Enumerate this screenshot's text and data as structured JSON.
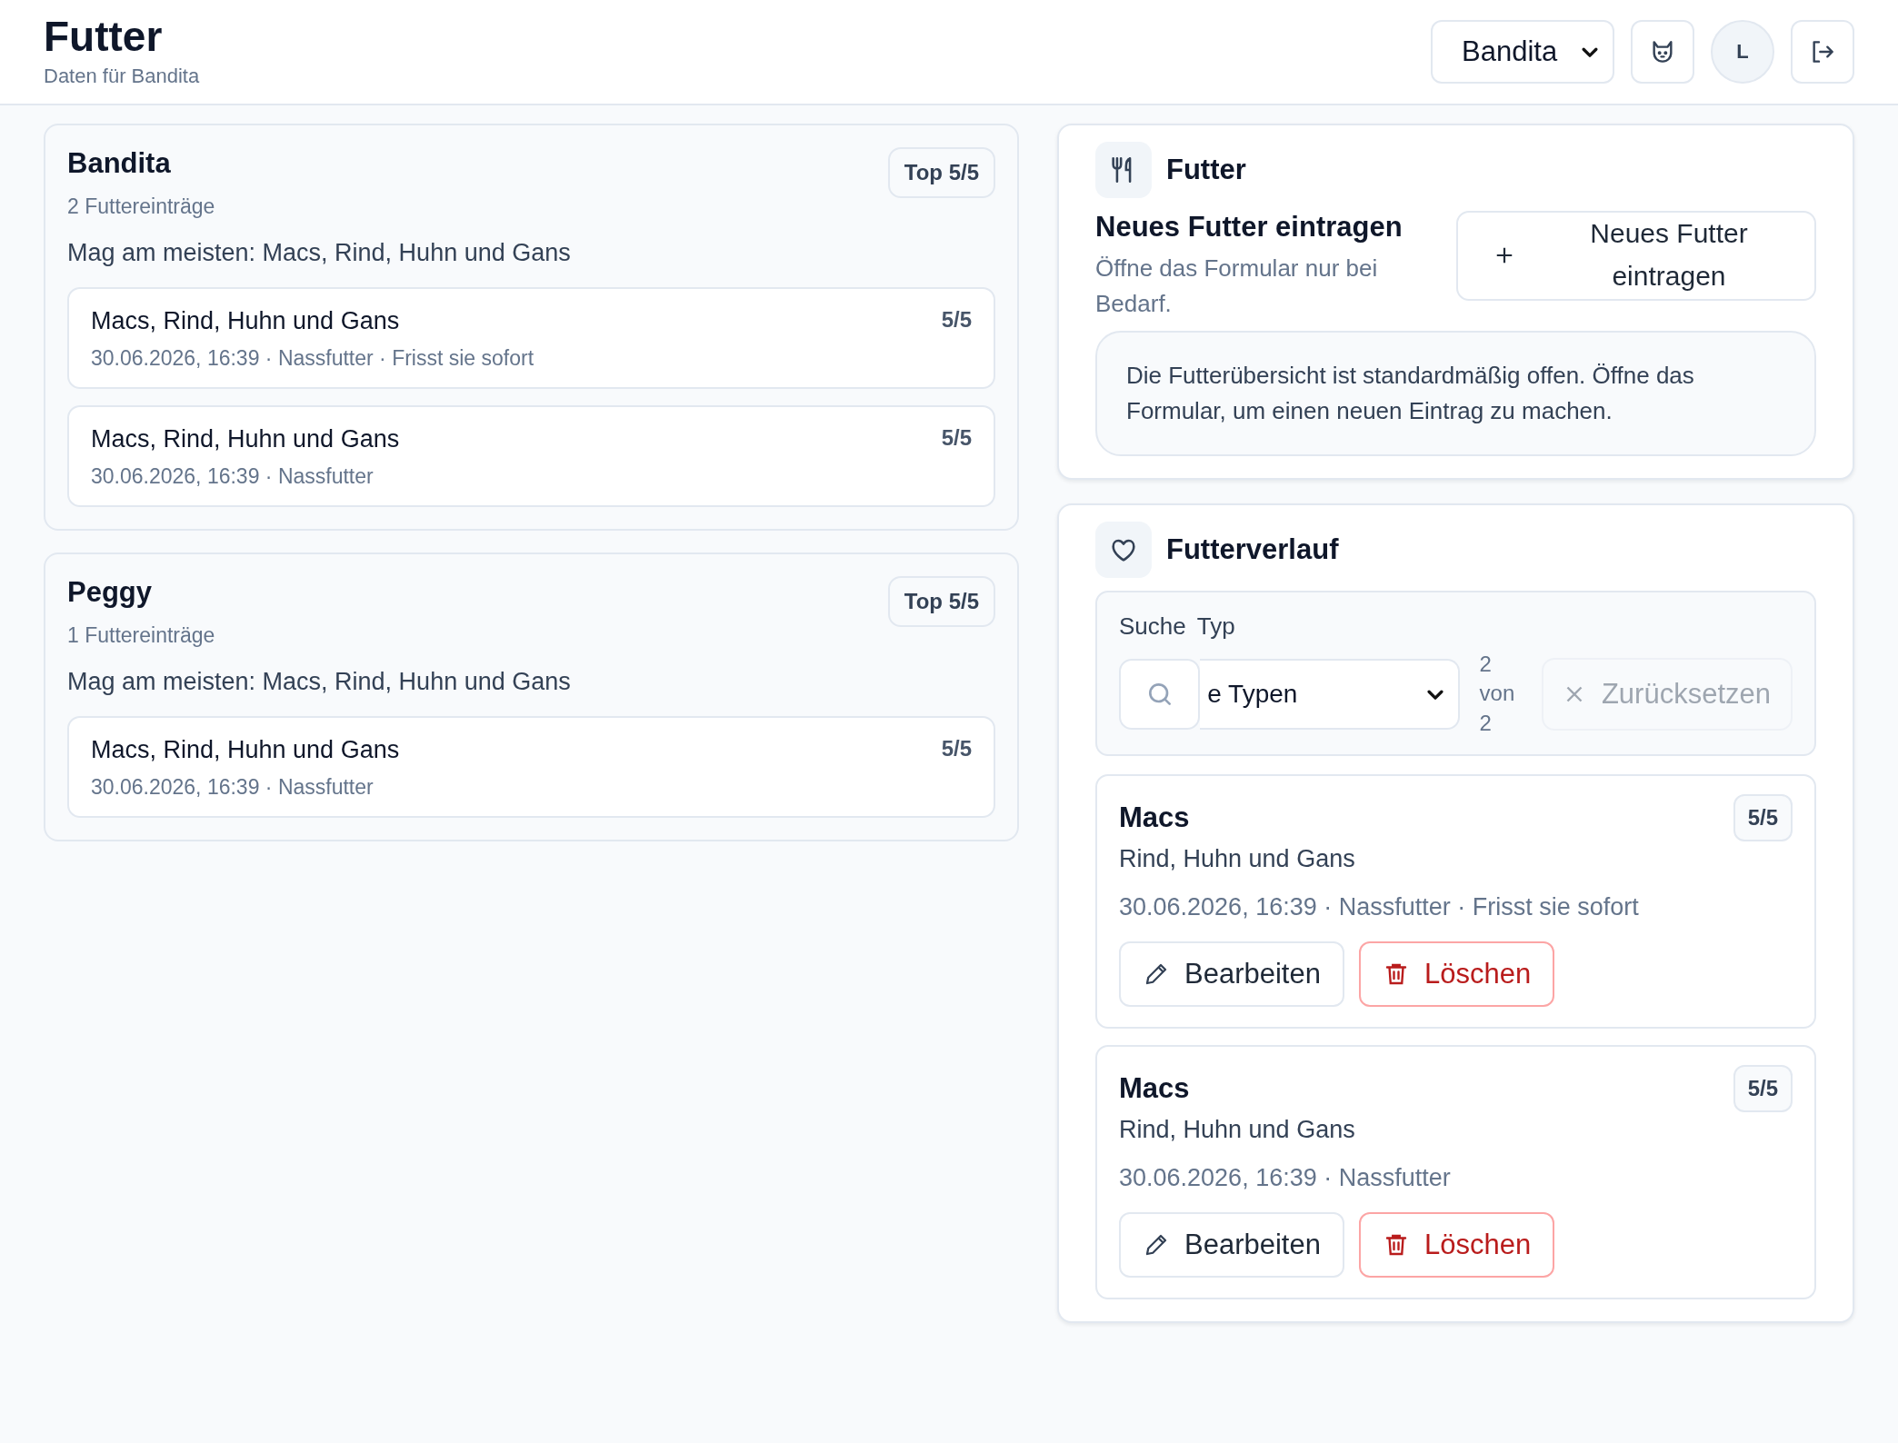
{
  "header": {
    "title": "Futter",
    "subtitle": "Daten für Bandita",
    "pet_select": "Bandita",
    "avatar": "L"
  },
  "cats": [
    {
      "name": "Bandita",
      "badge": "Top 5/5",
      "count": "2 Futtereinträge",
      "favorite": "Mag am meisten: Macs, Rind, Huhn und Gans",
      "entries": [
        {
          "title": "Macs, Rind, Huhn und Gans",
          "rating": "5/5",
          "meta": "30.06.2026, 16:39 · Nassfutter · Frisst sie sofort"
        },
        {
          "title": "Macs, Rind, Huhn und Gans",
          "rating": "5/5",
          "meta": "30.06.2026, 16:39 · Nassfutter"
        }
      ]
    },
    {
      "name": "Peggy",
      "badge": "Top 5/5",
      "count": "1 Futtereinträge",
      "favorite": "Mag am meisten: Macs, Rind, Huhn und Gans",
      "entries": [
        {
          "title": "Macs, Rind, Huhn und Gans",
          "rating": "5/5",
          "meta": "30.06.2026, 16:39 · Nassfutter"
        }
      ]
    }
  ],
  "futter_panel": {
    "title": "Futter",
    "heading": "Neues Futter eintragen",
    "hint": "Öffne das Formular nur bei Bedarf.",
    "add_button": "Neues Futter eintragen",
    "info": "Die Futterübersicht ist standardmäßig offen. Öffne das Formular, um einen neuen Eintrag zu machen."
  },
  "history": {
    "title": "Futterverlauf",
    "filter": {
      "search_label": "Suche",
      "type_label": "Typ",
      "type_value": "e Typen",
      "count": "2 von 2",
      "reset_button": "Zurücksetzen",
      "reset_disabled": true
    },
    "entries": [
      {
        "name": "Macs",
        "rating": "5/5",
        "description": "Rind, Huhn und Gans",
        "meta": "30.06.2026, 16:39 · Nassfutter · Frisst sie sofort",
        "edit_button": "Bearbeiten",
        "delete_button": "Löschen"
      },
      {
        "name": "Macs",
        "rating": "5/5",
        "description": "Rind, Huhn und Gans",
        "meta": "30.06.2026, 16:39 · Nassfutter",
        "edit_button": "Bearbeiten",
        "delete_button": "Löschen"
      }
    ]
  }
}
